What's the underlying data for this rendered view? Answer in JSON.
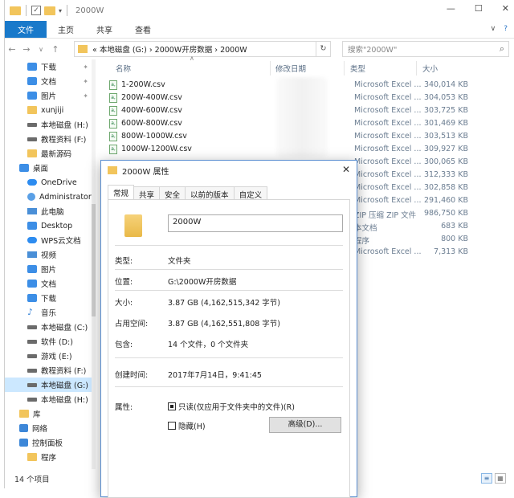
{
  "window": {
    "title": "2000W",
    "controls": [
      "—",
      "☐",
      "✕"
    ]
  },
  "ribbon": {
    "tabs": [
      "文件",
      "主页",
      "共享",
      "查看"
    ],
    "right": [
      "∨",
      "?"
    ]
  },
  "nav": {
    "back": "←",
    "forward": "→",
    "recent": "∨",
    "up": "↑",
    "path": "« 本地磁盘 (G:) › 2000W开房数据 › 2000W",
    "refresh": "↻",
    "search_placeholder": "搜索\"2000W\""
  },
  "sidebar": {
    "items": [
      {
        "label": "下载",
        "icon": "download-icon",
        "pinned": true
      },
      {
        "label": "文档",
        "icon": "document-icon",
        "pinned": true
      },
      {
        "label": "图片",
        "icon": "picture-icon",
        "pinned": true
      },
      {
        "label": "xunjiji",
        "icon": "folder-icon"
      },
      {
        "label": "本地磁盘 (H:)",
        "icon": "drive-icon"
      },
      {
        "label": "教程资料 (F:)",
        "icon": "drive-icon"
      },
      {
        "label": "最新源码",
        "icon": "folder-icon"
      },
      {
        "label": "桌面",
        "icon": "desktop-icon",
        "level0": true
      },
      {
        "label": "OneDrive",
        "icon": "cloud-icon"
      },
      {
        "label": "Administrator",
        "icon": "user-icon"
      },
      {
        "label": "此电脑",
        "icon": "pc-icon"
      },
      {
        "label": "Desktop",
        "icon": "desktop-icon"
      },
      {
        "label": "WPS云文档",
        "icon": "cloud-icon"
      },
      {
        "label": "视频",
        "icon": "video-icon"
      },
      {
        "label": "图片",
        "icon": "picture-icon"
      },
      {
        "label": "文档",
        "icon": "document-icon"
      },
      {
        "label": "下载",
        "icon": "download-icon"
      },
      {
        "label": "音乐",
        "icon": "music-icon"
      },
      {
        "label": "本地磁盘 (C:)",
        "icon": "drive-icon"
      },
      {
        "label": "软件 (D:)",
        "icon": "drive-icon"
      },
      {
        "label": "游戏 (E:)",
        "icon": "drive-icon"
      },
      {
        "label": "教程资料 (F:)",
        "icon": "drive-icon"
      },
      {
        "label": "本地磁盘 (G:)",
        "icon": "drive-icon",
        "selected": true
      },
      {
        "label": "本地磁盘 (H:)",
        "icon": "drive-icon"
      },
      {
        "label": "库",
        "icon": "library-icon",
        "level0": true
      },
      {
        "label": "网络",
        "icon": "network-icon",
        "level0": true
      },
      {
        "label": "控制面板",
        "icon": "control-panel-icon",
        "level0": true
      },
      {
        "label": "程序",
        "icon": "folder-icon"
      }
    ]
  },
  "columns": {
    "name": "名称",
    "modified": "修改日期",
    "type": "类型",
    "size": "大小"
  },
  "files": [
    {
      "name": "1-200W.csv",
      "type": "Microsoft Excel ...",
      "size": "340,014 KB"
    },
    {
      "name": "200W-400W.csv",
      "type": "Microsoft Excel ...",
      "size": "304,053 KB"
    },
    {
      "name": "400W-600W.csv",
      "type": "Microsoft Excel ...",
      "size": "303,725 KB"
    },
    {
      "name": "600W-800W.csv",
      "type": "Microsoft Excel ...",
      "size": "301,469 KB"
    },
    {
      "name": "800W-1000W.csv",
      "type": "Microsoft Excel ...",
      "size": "303,513 KB"
    },
    {
      "name": "1000W-1200W.csv",
      "type": "Microsoft Excel ...",
      "size": "309,927 KB"
    },
    {
      "name": "",
      "type": "Microsoft Excel ...",
      "size": "300,065 KB"
    },
    {
      "name": "",
      "type": "Microsoft Excel ...",
      "size": "312,333 KB"
    },
    {
      "name": "",
      "type": "Microsoft Excel ...",
      "size": "302,858 KB"
    },
    {
      "name": "",
      "type": "Microsoft Excel ...",
      "size": "291,460 KB"
    },
    {
      "name": "",
      "type": "ZIP 压缩 ZIP 文件",
      "size": "986,750 KB"
    },
    {
      "name": "",
      "type": "本文档",
      "size": "683 KB"
    },
    {
      "name": "",
      "type": "程序",
      "size": "800 KB"
    },
    {
      "name": "",
      "type": "Microsoft Excel ...",
      "size": "7,313 KB"
    }
  ],
  "status": {
    "count": "14 个项目"
  },
  "dialog": {
    "title": "2000W 属性",
    "tabs": [
      "常规",
      "共享",
      "安全",
      "以前的版本",
      "自定义"
    ],
    "name_value": "2000W",
    "type_label": "类型:",
    "type_value": "文件夹",
    "location_label": "位置:",
    "location_value": "G:\\2000W开房数据",
    "size_label": "大小:",
    "size_value": "3.87 GB (4,162,515,342 字节)",
    "disk_label": "占用空间:",
    "disk_value": "3.87 GB (4,162,551,808 字节)",
    "contains_label": "包含:",
    "contains_value": "14 个文件，0 个文件夹",
    "created_label": "创建时间:",
    "created_value": "2017年7月14日，9:41:45",
    "attr_label": "属性:",
    "readonly_label": "只读(仅应用于文件夹中的文件)(R)",
    "hidden_label": "隐藏(H)",
    "advanced_label": "高级(D)...",
    "close": "✕"
  }
}
